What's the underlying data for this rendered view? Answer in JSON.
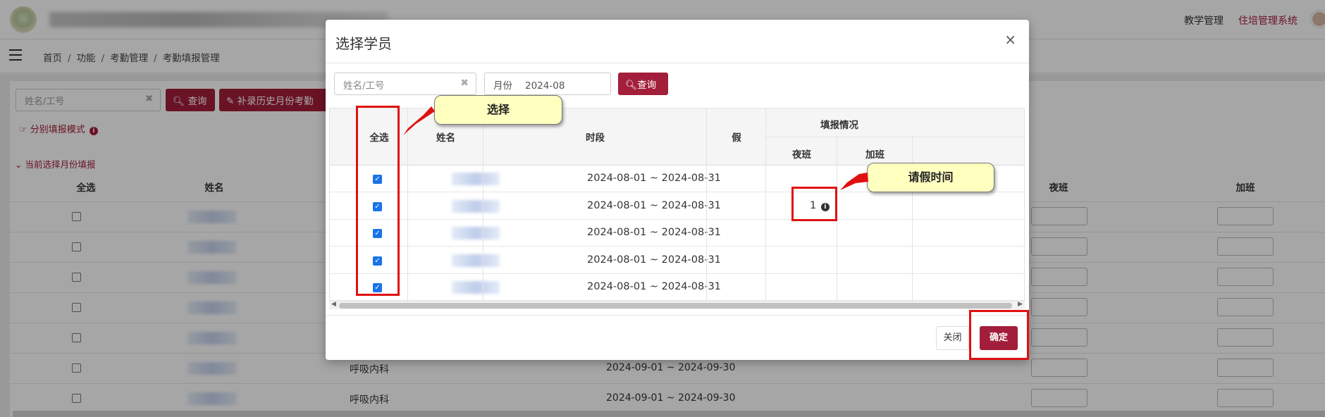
{
  "app": {
    "nav_teaching": "教学管理",
    "nav_system": "住培管理系统"
  },
  "breadcrumb": [
    "首页",
    "功能",
    "考勤管理",
    "考勤填报管理"
  ],
  "background": {
    "search_placeholder": "姓名/工号",
    "query_label": "查询",
    "supplement_label": "补录历史月份考勤",
    "mode_link": "分别填报模式",
    "month_link": "当前选择月份填报",
    "columns": [
      "全选",
      "姓名",
      "夜班",
      "加班"
    ],
    "rows": [
      {
        "dept": "",
        "period": ""
      },
      {
        "dept": "",
        "period": ""
      },
      {
        "dept": "",
        "period": ""
      },
      {
        "dept": "",
        "period": ""
      },
      {
        "dept": "",
        "period": ""
      },
      {
        "dept": "呼吸内科",
        "period": "2024-09-01 ~ 2024-09-30"
      },
      {
        "dept": "呼吸内科",
        "period": "2024-09-01 ~ 2024-09-30"
      }
    ]
  },
  "modal": {
    "title": "选择学员",
    "close_icon": "×",
    "name_placeholder": "姓名/工号",
    "month_label": "月份",
    "month_value": "2024-08",
    "query_label": "查询",
    "columns": {
      "select_all": "全选",
      "name": "姓名",
      "period": "时段",
      "leave": "假",
      "report_group": "填报情况",
      "night": "夜班",
      "overtime": "加班"
    },
    "rows": [
      {
        "checked": true,
        "period": "2024-08-01 ~ 2024-08-31",
        "leave": ""
      },
      {
        "checked": true,
        "period": "2024-08-01 ~ 2024-08-31",
        "leave": "1"
      },
      {
        "checked": true,
        "period": "2024-08-01 ~ 2024-08-31",
        "leave": ""
      },
      {
        "checked": true,
        "period": "2024-08-01 ~ 2024-08-31",
        "leave": ""
      },
      {
        "checked": true,
        "period": "2024-08-01 ~ 2024-08-31",
        "leave": ""
      }
    ],
    "close_button": "关闭",
    "confirm_button": "确定"
  },
  "annotations": {
    "select": "选择",
    "leave_time": "请假时间"
  },
  "colors": {
    "brand": "#a31e3a",
    "annotation_red": "#e01010",
    "callout_bg": "#ffffc0"
  }
}
